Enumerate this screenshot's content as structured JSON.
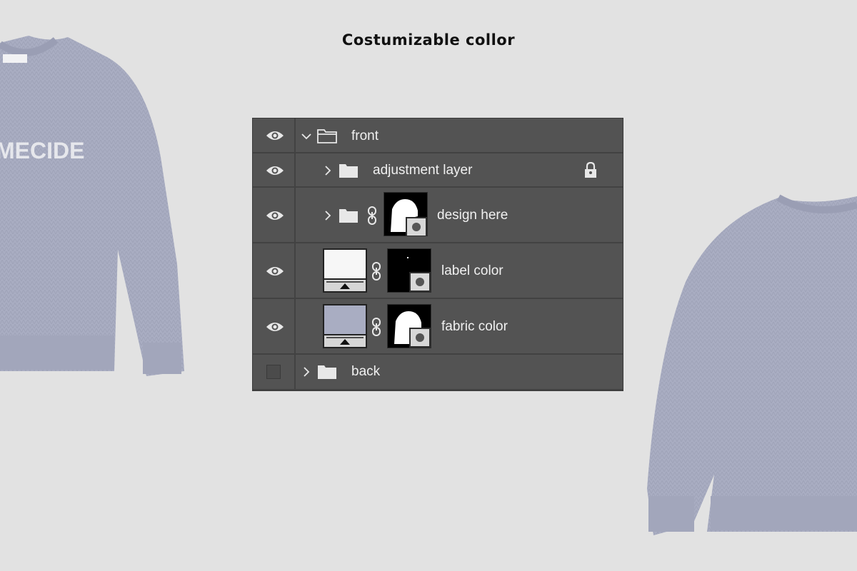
{
  "headline": "Costumizable collor",
  "sweater_front_print": "MECIDE",
  "colors": {
    "background": "#e2e2e2",
    "panel": "#535353",
    "fabric": "#a9adc2",
    "label_swatch": "#f7f7f7"
  },
  "layers": [
    {
      "name": "front",
      "type": "group",
      "expanded": true,
      "visible": true,
      "icon": "folder-open-icon"
    },
    {
      "name": "adjustment layer",
      "type": "group",
      "expanded": false,
      "visible": true,
      "locked": true,
      "icon": "folder-icon"
    },
    {
      "name": "design here",
      "type": "group-with-mask",
      "expanded": false,
      "visible": true,
      "icon": "folder-icon"
    },
    {
      "name": "label color",
      "type": "fill-layer",
      "visible": true,
      "swatch": "#f7f7f7"
    },
    {
      "name": "fabric color",
      "type": "fill-layer",
      "visible": true,
      "swatch": "#a9adc2"
    },
    {
      "name": "back",
      "type": "group",
      "expanded": false,
      "visible": false,
      "icon": "folder-icon"
    }
  ]
}
